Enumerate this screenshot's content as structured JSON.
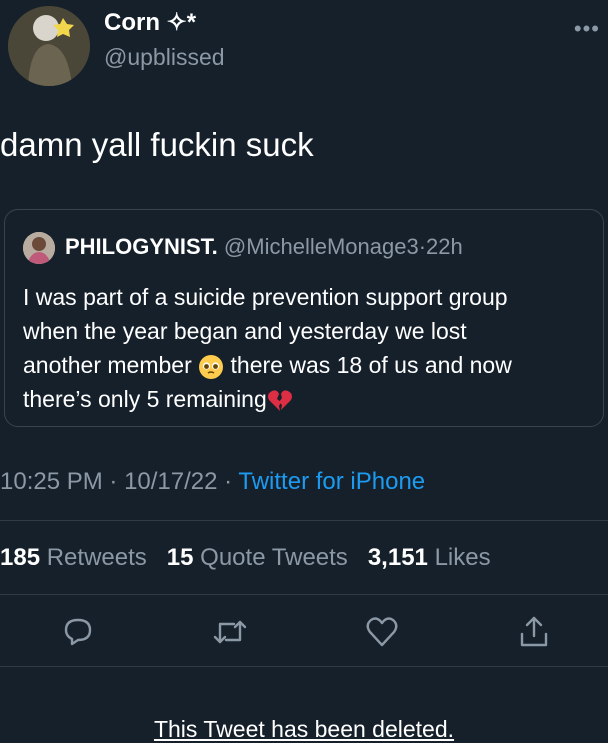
{
  "author": {
    "name": "Corn ✧*",
    "handle": "@upblissed"
  },
  "menu_icon": "more-icon",
  "tweet_text": "damn yall fuckin suck",
  "quote": {
    "name": "PHILOGYNIST.",
    "handle": "@MichelleMonage3",
    "separator": "·",
    "age": "22h",
    "line1": "I was part of a suicide prevention support group",
    "line2": "when the year began and yesterday we lost",
    "line3a": "another member",
    "emoji1": "pleading-face-emoji",
    "line3b": " there was 18 of us and now",
    "line4a": "there’s only 5 remaining",
    "emoji2": "broken-heart-emoji"
  },
  "meta": {
    "time": "10:25 PM",
    "sep1": " · ",
    "date": "10/17/22",
    "sep2": " · ",
    "source": "Twitter for iPhone"
  },
  "stats": {
    "retweets_count": "185",
    "retweets_label": "Retweets",
    "quotes_count": "15",
    "quotes_label": "Quote Tweets",
    "likes_count": "3,151",
    "likes_label": "Likes"
  },
  "actions": [
    "reply-icon",
    "retweet-icon",
    "like-icon",
    "share-icon"
  ],
  "colors": {
    "background": "#15202b",
    "secondary_text": "#8b98a5",
    "link": "#1d9bf0",
    "border": "#38444d"
  },
  "deleted_notice": "This Tweet has been deleted."
}
